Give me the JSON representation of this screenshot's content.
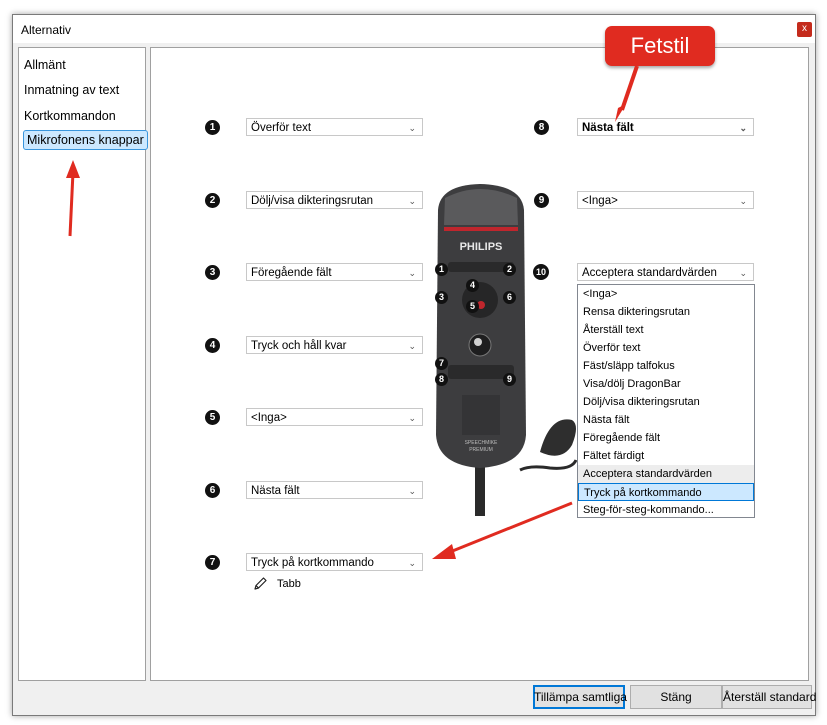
{
  "window": {
    "title": "Alternativ",
    "close_label": "x"
  },
  "sidebar": {
    "items": [
      {
        "label": "Allmänt"
      },
      {
        "label": "Inmatning av text"
      },
      {
        "label": "Kortkommandon"
      },
      {
        "label": "Mikrofonens knappar",
        "selected": true
      }
    ]
  },
  "buttons": {
    "1": {
      "number": "1",
      "value": "Överför text"
    },
    "2": {
      "number": "2",
      "value": "Dölj/visa dikteringsrutan"
    },
    "3": {
      "number": "3",
      "value": "Föregående fält"
    },
    "4": {
      "number": "4",
      "value": "Tryck och håll kvar"
    },
    "5": {
      "number": "5",
      "value": "<Inga>"
    },
    "6": {
      "number": "6",
      "value": "Nästa fält"
    },
    "7": {
      "number": "7",
      "value": "Tryck på kortkommando",
      "shortcut": "Tabb"
    },
    "8": {
      "number": "8",
      "value": "Nästa fält"
    },
    "9": {
      "number": "9",
      "value": "<Inga>"
    },
    "10": {
      "number": "10",
      "value": "Acceptera standardvärden"
    }
  },
  "dropdown_list": {
    "options": [
      "<Inga>",
      "Rensa dikteringsrutan",
      "Återställ text",
      "Överför text",
      "Fäst/släpp talfokus",
      "Visa/dölj DragonBar",
      "Dölj/visa dikteringsrutan",
      "Nästa fält",
      "Föregående fält",
      "Fältet färdigt",
      "Acceptera standardvärden",
      "Tryck på kortkommando",
      "Steg-för-steg-kommando..."
    ],
    "hovered": "Acceptera standardvärden",
    "selected": "Tryck på kortkommando"
  },
  "annotation": {
    "callout_text": "Fetstil"
  },
  "microphone": {
    "brand": "PHILIPS",
    "model_line1": "SPEECHMIKE",
    "model_line2": "PREMIUM"
  },
  "footer": {
    "apply_all": "Tillämpa samtliga",
    "close": "Stäng",
    "reset": "Återställ standard"
  },
  "colors": {
    "accent": "#0078d7",
    "annotation_red": "#e02b20",
    "selected_bg": "#cce8ff"
  }
}
